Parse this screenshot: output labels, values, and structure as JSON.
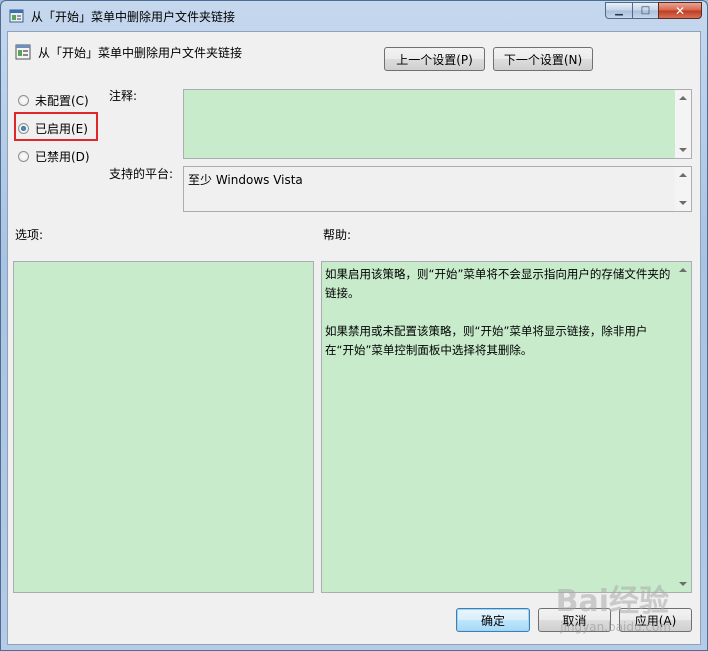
{
  "window": {
    "title": "从「开始」菜单中删除用户文件夹链接"
  },
  "header": {
    "policy_name": "从「开始」菜单中删除用户文件夹链接",
    "prev_label": "上一个设置(P)",
    "next_label": "下一个设置(N)"
  },
  "state": {
    "options": [
      {
        "label": "未配置(C)",
        "checked": false
      },
      {
        "label": "已启用(E)",
        "checked": true
      },
      {
        "label": "已禁用(D)",
        "checked": false
      }
    ]
  },
  "comment": {
    "label": "注释:",
    "value": ""
  },
  "platform": {
    "label": "支持的平台:",
    "value": "至少 Windows Vista"
  },
  "options_panel": {
    "label": "选项:"
  },
  "help_panel": {
    "label": "帮助:",
    "paragraphs": [
      "如果启用该策略，则“开始”菜单将不会显示指向用户的存储文件夹的链接。",
      "如果禁用或未配置该策略，则“开始”菜单将显示链接，除非用户在“开始”菜单控制面板中选择将其删除。"
    ]
  },
  "footer": {
    "ok_label": "确定",
    "cancel_label": "取消",
    "apply_label": "应用(A)"
  },
  "watermark": {
    "main": "Bai经验",
    "sub": "jingyan.baidu.com"
  },
  "colors": {
    "field_background": "#c7ebcb",
    "highlight_border": "#e0262b"
  }
}
